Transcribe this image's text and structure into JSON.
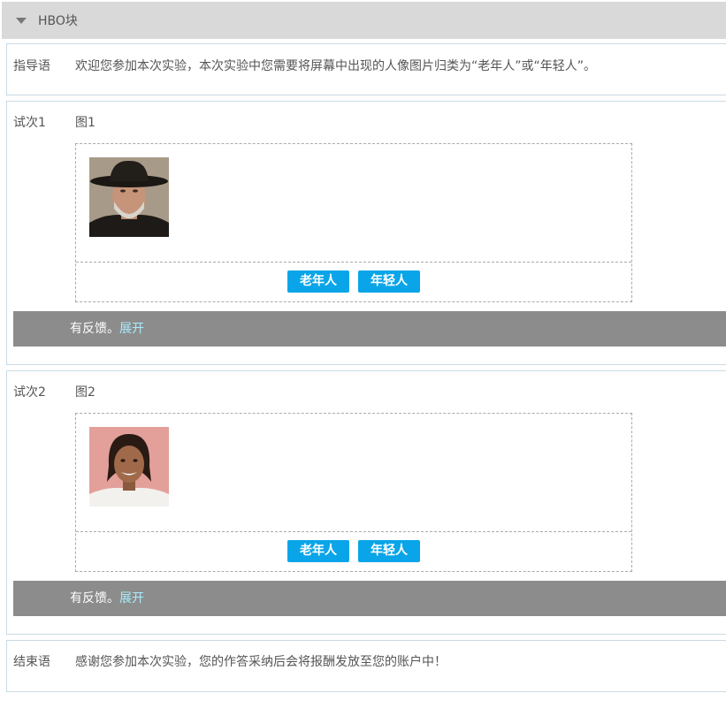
{
  "hbo": {
    "title": "HBO块"
  },
  "instruction": {
    "label": "指导语",
    "text": "欢迎您参加本次实验，本次实验中您需要将屏幕中出现的人像图片归类为“老年人”或“年轻人”。"
  },
  "trials": [
    {
      "label": "试次1",
      "image_title": "图1",
      "buttons": [
        "老年人",
        "年轻人"
      ],
      "feedback": "有反馈。",
      "expand": "展开"
    },
    {
      "label": "试次2",
      "image_title": "图2",
      "buttons": [
        "老年人",
        "年轻人"
      ],
      "feedback": "有反馈。",
      "expand": "展开"
    }
  ],
  "ending": {
    "label": "结束语",
    "text": "感谢您参加本次实验，您的作答采纳后会将报酬发放至您的账户中！"
  },
  "colors": {
    "header_bg": "#d9d9d9",
    "button_bg": "#0aa5e8",
    "feedback_bg": "#8c8c8c",
    "expand_link": "#a8ecfc",
    "section_border": "#c9dbe6"
  },
  "icons": {
    "collapse": "caret-down-icon"
  }
}
